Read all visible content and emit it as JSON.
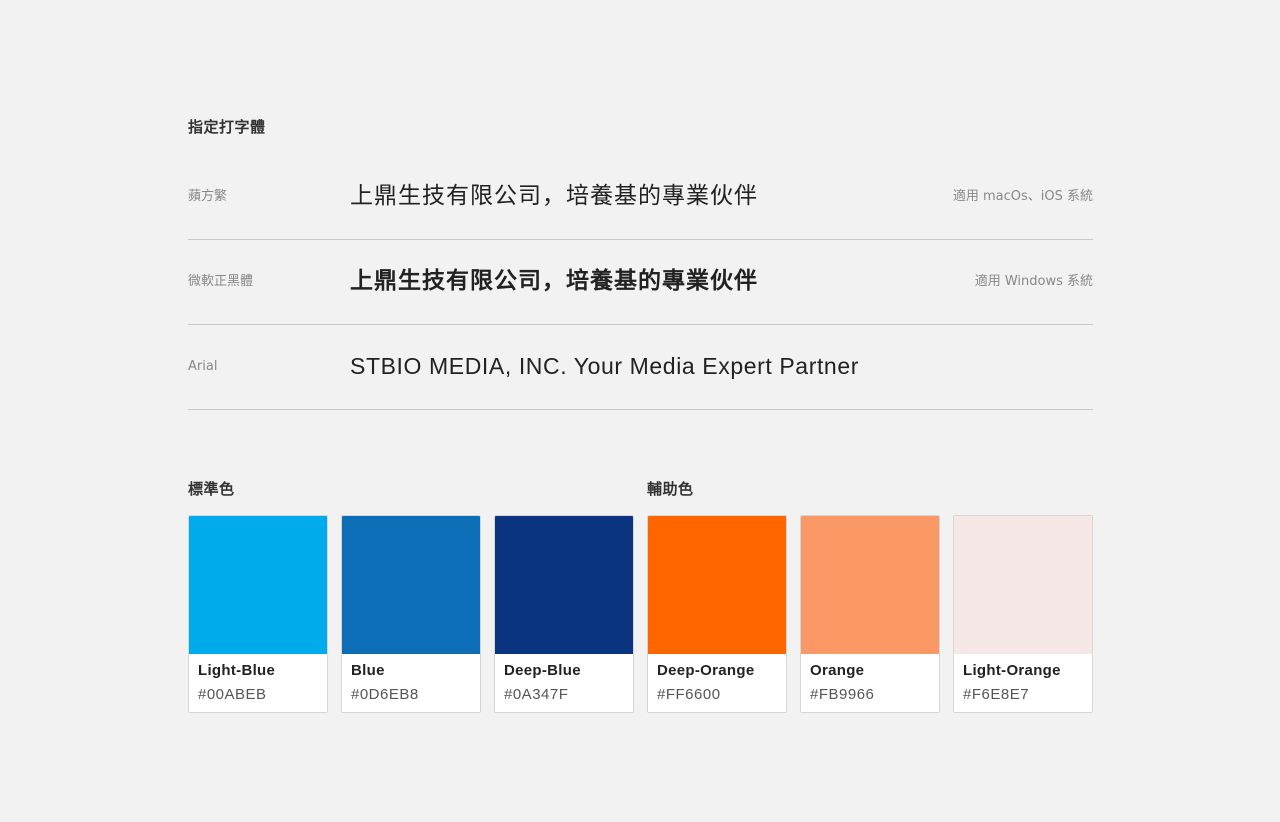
{
  "typography": {
    "title": "指定打字體",
    "rows": [
      {
        "font_name": "蘋方繁",
        "sample": "上鼎生技有限公司，培養基的專業伙伴",
        "note": "適用 macOs、iOS 系統"
      },
      {
        "font_name": "微軟正黑體",
        "sample": "上鼎生技有限公司，培養基的專業伙伴",
        "note": "適用 Windows 系統"
      },
      {
        "font_name": "Arial",
        "sample": "STBIO MEDIA, INC. Your Media Expert Partner",
        "note": ""
      }
    ]
  },
  "colors": {
    "standard_title": "標準色",
    "auxiliary_title": "輔助色",
    "swatches": [
      {
        "name": "Light-Blue",
        "hex": "#00ABEB"
      },
      {
        "name": "Blue",
        "hex": "#0D6EB8"
      },
      {
        "name": "Deep-Blue",
        "hex": "#0A347F"
      },
      {
        "name": "Deep-Orange",
        "hex": "#FF6600"
      },
      {
        "name": "Orange",
        "hex": "#FB9966"
      },
      {
        "name": "Light-Orange",
        "hex": "#F6E8E7"
      }
    ]
  }
}
